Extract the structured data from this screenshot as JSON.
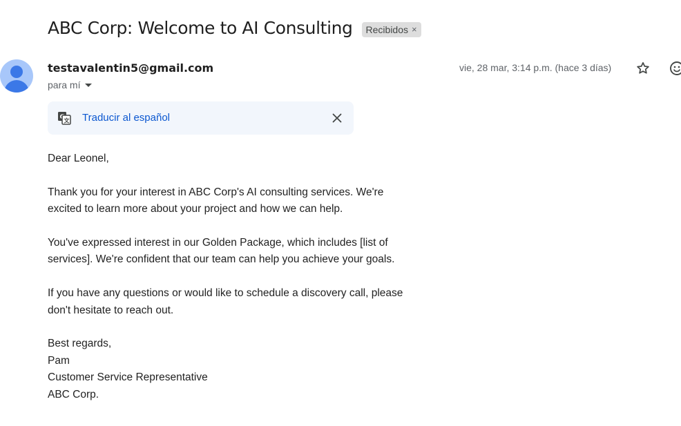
{
  "email": {
    "subject": "ABC Corp: Welcome to AI Consulting",
    "label": "Recibidos",
    "label_close": "×",
    "sender": "testavalentin5@gmail.com",
    "recipient": "para mí",
    "date": "vie, 28 mar, 3:14 p.m. (hace 3 días)",
    "translate_label": "Traducir al español",
    "greeting": "Dear Leonel,",
    "paragraphs": [
      "Thank you for your interest in ABC Corp's AI consulting services. We're excited to learn more about your project and how we can help.",
      "You've expressed interest in our Golden Package, which includes [list of services]. We're confident that our team can help you achieve your goals.",
      "If you have any questions or would like to schedule a discovery call, please don't hesitate to reach out."
    ],
    "signature": [
      "Best regards,",
      "Pam",
      "Customer Service Representative",
      "ABC Corp."
    ]
  },
  "icons": {
    "avatar": "person-avatar-icon",
    "star": "star-outline-icon",
    "emoji": "emoji-react-icon",
    "translate": "translate-icon",
    "close": "close-icon",
    "caret": "caret-down-icon"
  },
  "colors": {
    "link_blue": "#0b57d0",
    "banner_bg": "#f2f6fc",
    "chip_bg": "#dddddd",
    "avatar_bg": "#a8c7fa",
    "avatar_fg": "#3b78e7"
  }
}
